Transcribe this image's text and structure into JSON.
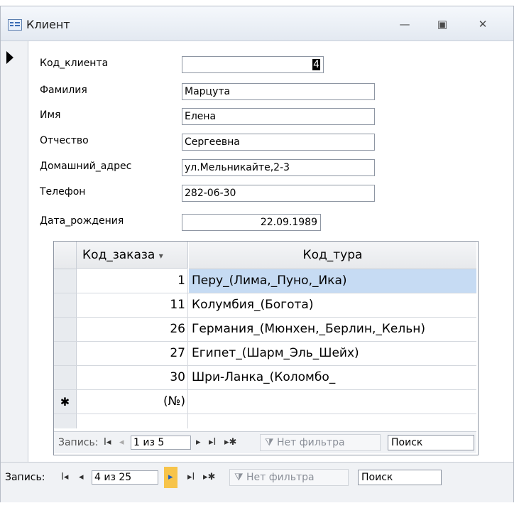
{
  "window": {
    "title": "Клиент",
    "minimize_glyph": "—",
    "restore_glyph": "▣",
    "close_glyph": "✕"
  },
  "form": {
    "fields": [
      {
        "label": "Код_клиента",
        "value": "4"
      },
      {
        "label": "Фамилия",
        "value": "Марцута"
      },
      {
        "label": "Имя",
        "value": "Елена"
      },
      {
        "label": "Отчество",
        "value": "Сергеевна"
      },
      {
        "label": "Домашний_адрес",
        "value": "ул.Мельникайте,2-3"
      },
      {
        "label": "Телефон",
        "value": "282-06-30"
      },
      {
        "label": "Дата_рождения",
        "value": "22.09.1989"
      }
    ]
  },
  "subform": {
    "columns": [
      "Код_заказа",
      "Код_тура"
    ],
    "sort_glyph": "▾",
    "rows": [
      {
        "code": "1",
        "tour": "Перу_(Лима,_Пуно,_Ика)",
        "selected": true
      },
      {
        "code": "11",
        "tour": "Колумбия_(Богота)"
      },
      {
        "code": "26",
        "tour": "Германия_(Мюнхен,_Берлин,_Кельн)"
      },
      {
        "code": "27",
        "tour": "Египет_(Шарм_Эль_Шейх)"
      },
      {
        "code": "30",
        "tour": "Шри-Ланка_(Коломбо_"
      }
    ],
    "new_row_marker": "✱",
    "new_row_code": "(№)",
    "nav": {
      "label": "Запись:",
      "position": "1 из 5",
      "filter": "Нет фильтра",
      "search": "Поиск"
    }
  },
  "main_nav": {
    "label": "Запись:",
    "position": "4 из 25",
    "filter": "Нет фильтра",
    "search": "Поиск"
  },
  "icons": {
    "first": "I◂",
    "prev": "◂",
    "next": "▸",
    "last": "▸I",
    "new": "▸✱"
  },
  "colors": {
    "selected_row": "#c6dbf3",
    "next_highlight": "#f7c44a"
  }
}
